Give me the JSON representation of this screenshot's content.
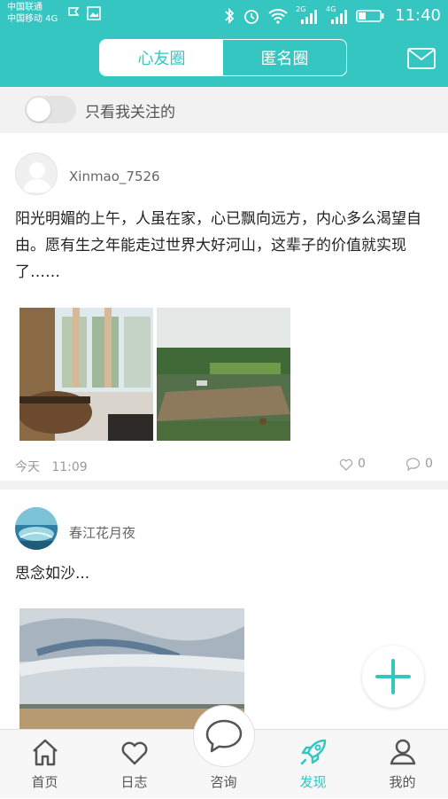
{
  "status_bar": {
    "carrier_1": "中国联通",
    "carrier_2": "中国移动 4G",
    "network_2g": "2G",
    "network_4g": "4G",
    "time": "11:40"
  },
  "header": {
    "tab_friends": "心友圈",
    "tab_anonymous": "匿名圈",
    "active_tab": "心友圈"
  },
  "filter": {
    "label": "只看我关注的",
    "toggle_on": false
  },
  "posts": [
    {
      "username": "Xinmao_7526",
      "text": "阳光明媚的上午，人虽在家，心已飘向远方，内心多么渴望自由。愿有生之年能走过世界大好河山，这辈子的价值就实现了……",
      "date": "今天",
      "time": "11:09",
      "likes": "0",
      "comments": "0"
    },
    {
      "username": "春江花月夜",
      "text": "思念如沙..."
    }
  ],
  "bottom_nav": [
    {
      "label": "首页",
      "icon": "home-icon"
    },
    {
      "label": "日志",
      "icon": "heart-icon"
    },
    {
      "label": "咨询",
      "icon": "chat-bubble-icon"
    },
    {
      "label": "发现",
      "icon": "rocket-icon"
    },
    {
      "label": "我的",
      "icon": "user-icon"
    }
  ],
  "colors": {
    "accent": "#35c6c2",
    "background": "#f2f2f2"
  }
}
